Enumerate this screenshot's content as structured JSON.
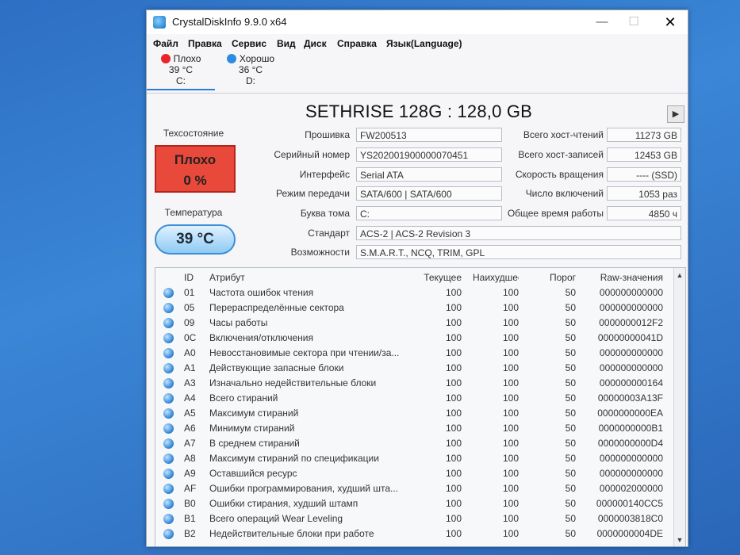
{
  "window": {
    "title": "CrystalDiskInfo 9.9.0 x64",
    "min_glyph": "—",
    "max_glyph": "☐",
    "close_glyph": "✕"
  },
  "menu": [
    "Файл",
    "Правка",
    "Сервис",
    "Вид",
    "Диск",
    "Справка",
    "Язык(Language)"
  ],
  "drives": [
    {
      "status": "Плохо",
      "temp": "39 °C",
      "letter": "C:",
      "color": "#e8262a"
    },
    {
      "status": "Хорошо",
      "temp": "36 °C",
      "letter": "D:",
      "color": "#2f8be0"
    }
  ],
  "disk": {
    "model": "SETHRISE 128G : 128,0 GB",
    "play_glyph": "▶",
    "health_label": "Техсостояние",
    "health_status": "Плохо",
    "health_percent": "0 %",
    "temp_label": "Температура",
    "temp_value": "39 °C",
    "left_fields": [
      {
        "label": "Прошивка",
        "value": "FW200513"
      },
      {
        "label": "Серийный номер",
        "value": "YS202001900000070451"
      },
      {
        "label": "Интерфейс",
        "value": "Serial ATA"
      },
      {
        "label": "Режим передачи",
        "value": "SATA/600 | SATA/600"
      },
      {
        "label": "Буква тома",
        "value": "C:"
      }
    ],
    "right_fields": [
      {
        "label": "Всего хост-чтений",
        "value": "11273 GB"
      },
      {
        "label": "Всего хост-записей",
        "value": "12453 GB"
      },
      {
        "label": "Скорость вращения",
        "value": "---- (SSD)"
      },
      {
        "label": "Число включений",
        "value": "1053 раз"
      },
      {
        "label": "Общее время работы",
        "value": "4850 ч"
      }
    ],
    "standard": {
      "label": "Стандарт",
      "value": "ACS-2 | ACS-2 Revision 3"
    },
    "features": {
      "label": "Возможности",
      "value": "S.M.A.R.T., NCQ, TRIM, GPL"
    }
  },
  "smart": {
    "headers": {
      "id": "ID",
      "attr": "Атрибут",
      "cur": "Текущее",
      "worst": "Наихудшее",
      "thr": "Порог",
      "raw": "Raw-значения"
    },
    "rows": [
      {
        "id": "01",
        "attr": "Частота ошибок чтения",
        "cur": "100",
        "worst": "100",
        "thr": "50",
        "raw": "000000000000"
      },
      {
        "id": "05",
        "attr": "Перераспределённые сектора",
        "cur": "100",
        "worst": "100",
        "thr": "50",
        "raw": "000000000000"
      },
      {
        "id": "09",
        "attr": "Часы работы",
        "cur": "100",
        "worst": "100",
        "thr": "50",
        "raw": "0000000012F2"
      },
      {
        "id": "0C",
        "attr": "Включения/отключения",
        "cur": "100",
        "worst": "100",
        "thr": "50",
        "raw": "00000000041D"
      },
      {
        "id": "A0",
        "attr": "Невосстановимые сектора при чтении/за...",
        "cur": "100",
        "worst": "100",
        "thr": "50",
        "raw": "000000000000"
      },
      {
        "id": "A1",
        "attr": "Действующие запасные блоки",
        "cur": "100",
        "worst": "100",
        "thr": "50",
        "raw": "000000000000"
      },
      {
        "id": "A3",
        "attr": "Изначально недействительные блоки",
        "cur": "100",
        "worst": "100",
        "thr": "50",
        "raw": "000000000164"
      },
      {
        "id": "A4",
        "attr": "Всего стираний",
        "cur": "100",
        "worst": "100",
        "thr": "50",
        "raw": "00000003A13F"
      },
      {
        "id": "A5",
        "attr": "Максимум стираний",
        "cur": "100",
        "worst": "100",
        "thr": "50",
        "raw": "0000000000EA"
      },
      {
        "id": "A6",
        "attr": "Минимум стираний",
        "cur": "100",
        "worst": "100",
        "thr": "50",
        "raw": "0000000000B1"
      },
      {
        "id": "A7",
        "attr": "В среднем стираний",
        "cur": "100",
        "worst": "100",
        "thr": "50",
        "raw": "0000000000D4"
      },
      {
        "id": "A8",
        "attr": "Максимум стираний по спецификации",
        "cur": "100",
        "worst": "100",
        "thr": "50",
        "raw": "000000000000"
      },
      {
        "id": "A9",
        "attr": "Оставшийся ресурс",
        "cur": "100",
        "worst": "100",
        "thr": "50",
        "raw": "000000000000"
      },
      {
        "id": "AF",
        "attr": "Ошибки программирования, худший шта...",
        "cur": "100",
        "worst": "100",
        "thr": "50",
        "raw": "000002000000"
      },
      {
        "id": "B0",
        "attr": "Ошибки стирания, худший штамп",
        "cur": "100",
        "worst": "100",
        "thr": "50",
        "raw": "000000140CC5"
      },
      {
        "id": "B1",
        "attr": "Всего операций Wear Leveling",
        "cur": "100",
        "worst": "100",
        "thr": "50",
        "raw": "0000003818C0"
      },
      {
        "id": "B2",
        "attr": "Недействительные блоки при работе",
        "cur": "100",
        "worst": "100",
        "thr": "50",
        "raw": "0000000004DE"
      }
    ],
    "scroll_up": "▲",
    "scroll_down": "▼"
  }
}
